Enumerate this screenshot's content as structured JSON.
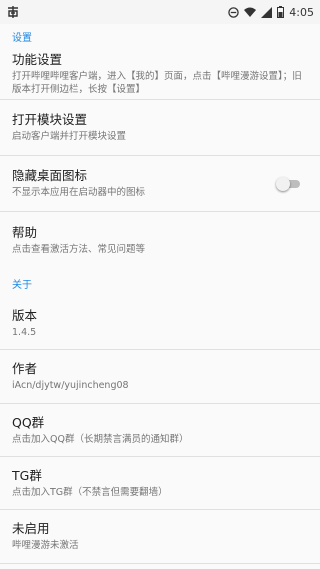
{
  "status_bar": {
    "time": "4:05",
    "icons": [
      "app-logo-icon",
      "minus-circle-icon",
      "wifi-icon",
      "signal-icon",
      "battery-icon"
    ]
  },
  "sections": {
    "settings": {
      "header": "设置",
      "items": [
        {
          "title": "功能设置",
          "summary": "打开哔哩哔哩客户端，进入【我的】页面，点击【哔哩漫游设置】；旧版本打开侧边栏，长按【设置】"
        },
        {
          "title": "打开模块设置",
          "summary": "启动客户端并打开模块设置"
        },
        {
          "title": "隐藏桌面图标",
          "summary": "不显示本应用在启动器中的图标",
          "toggle": false
        },
        {
          "title": "帮助",
          "summary": "点击查看激活方法、常见问题等"
        }
      ]
    },
    "about": {
      "header": "关于",
      "items": [
        {
          "title": "版本",
          "summary": "1.4.5"
        },
        {
          "title": "作者",
          "summary": "iAcn/djytw/yujincheng08"
        },
        {
          "title": "QQ群",
          "summary": "点击加入QQ群（长期禁言满员的通知群）"
        },
        {
          "title": "TG群",
          "summary": "点击加入TG群（不禁言但需要翻墙）"
        },
        {
          "title": "未启用",
          "summary": "哔哩漫游未激活"
        }
      ]
    }
  },
  "colors": {
    "accent": "#1e88e5",
    "background": "#fafafa",
    "divider": "#e0e0e0"
  }
}
